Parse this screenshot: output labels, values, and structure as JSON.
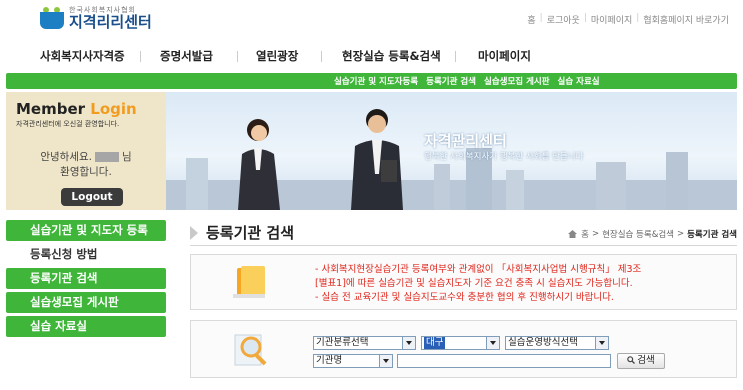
{
  "header": {
    "logo_sub": "한국사회복지사협회",
    "logo_main": "지격리리센터",
    "util_links": [
      "홈",
      "로그아웃",
      "마이페이지",
      "협회홈페이지 바로가기"
    ]
  },
  "gnb": [
    "사회복지사자격증",
    "증명서발급",
    "열린광장",
    "현장실습 등록&검색",
    "마이페이지"
  ],
  "subnav": [
    "실습기관 및 지도자등록",
    "등록기관 검색",
    "실습생모집 게시판",
    "실습 자료실"
  ],
  "member": {
    "title_member": "Member",
    "title_login": "Login",
    "welcome": "자격관리센터에 오신걸 환영합니다.",
    "greeting_prefix": "안녕하세요.",
    "greeting_suffix": "님",
    "greeting_line2": "환영합니다.",
    "logout": "Logout"
  },
  "banner": {
    "title": "자격관리센터",
    "subtitle": "행복한 사회복지사가 행복한 사회를 만듭니다"
  },
  "sidebar": [
    {
      "label": "실습기관 및 지도자 등록",
      "active": true
    },
    {
      "label": "등록신청 방법",
      "active": false
    },
    {
      "label": "등록기관 검색",
      "active": true
    },
    {
      "label": "실습생모집 게시판",
      "active": true
    },
    {
      "label": "실습 자료실",
      "active": true
    }
  ],
  "content": {
    "title": "등록기관 검색",
    "breadcrumb": [
      "홈",
      "현장실습 등록&검색",
      "등록기관 검색"
    ],
    "notice": [
      "- 사회복지현장실습기관 등록여부와 관계없이 「사회복지사업법 시행규칙」 제3조",
      "[별표1]에 따른 실습기관 및 실습지도자 기준 요건 충족 시 실습지도 가능합니다.",
      "- 실습 전 교육기관 및 실습지도교수와 충분한 협의 후 진행하시기 바랍니다."
    ]
  },
  "search": {
    "category": "기관분류선택",
    "region": "대구",
    "method": "실습운영방식선택",
    "field": "기관명",
    "keyword": "",
    "button": "검색"
  }
}
